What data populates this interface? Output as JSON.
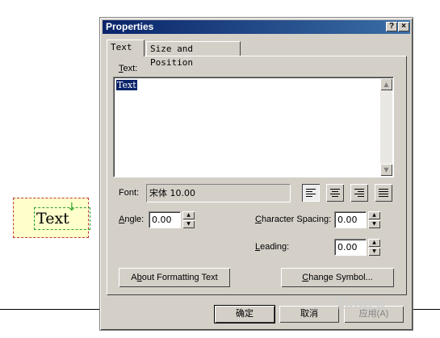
{
  "canvas": {
    "text_element": "Text"
  },
  "dialog": {
    "title": "Properties",
    "help_button": "?",
    "close_button": "×",
    "tabs": [
      {
        "label": "Text",
        "selected": true
      },
      {
        "label": "Size and Position",
        "selected": false
      }
    ],
    "text_label": "Text:",
    "text_value": "Text",
    "font_label": "Font:",
    "font_value": "宋体 10.00",
    "alignment_buttons": [
      {
        "name": "align-left",
        "selected": true
      },
      {
        "name": "align-center",
        "selected": false
      },
      {
        "name": "align-right",
        "selected": false
      },
      {
        "name": "align-justify",
        "selected": false
      }
    ],
    "angle_label": "Angle:",
    "angle_value": "0.00",
    "char_spacing_label": "Character Spacing:",
    "char_spacing_value": "0.00",
    "leading_label": "Leading:",
    "leading_value": "0.00",
    "about_button": "About Formatting Text",
    "change_symbol_button": "Change Symbol...",
    "ok_button": "确定",
    "cancel_button": "取消",
    "apply_button": "应用(A)"
  },
  "colors": {
    "titlebar": "#0a246a",
    "dialog_bg": "#d4d0c8",
    "selection": "#0a246a"
  }
}
